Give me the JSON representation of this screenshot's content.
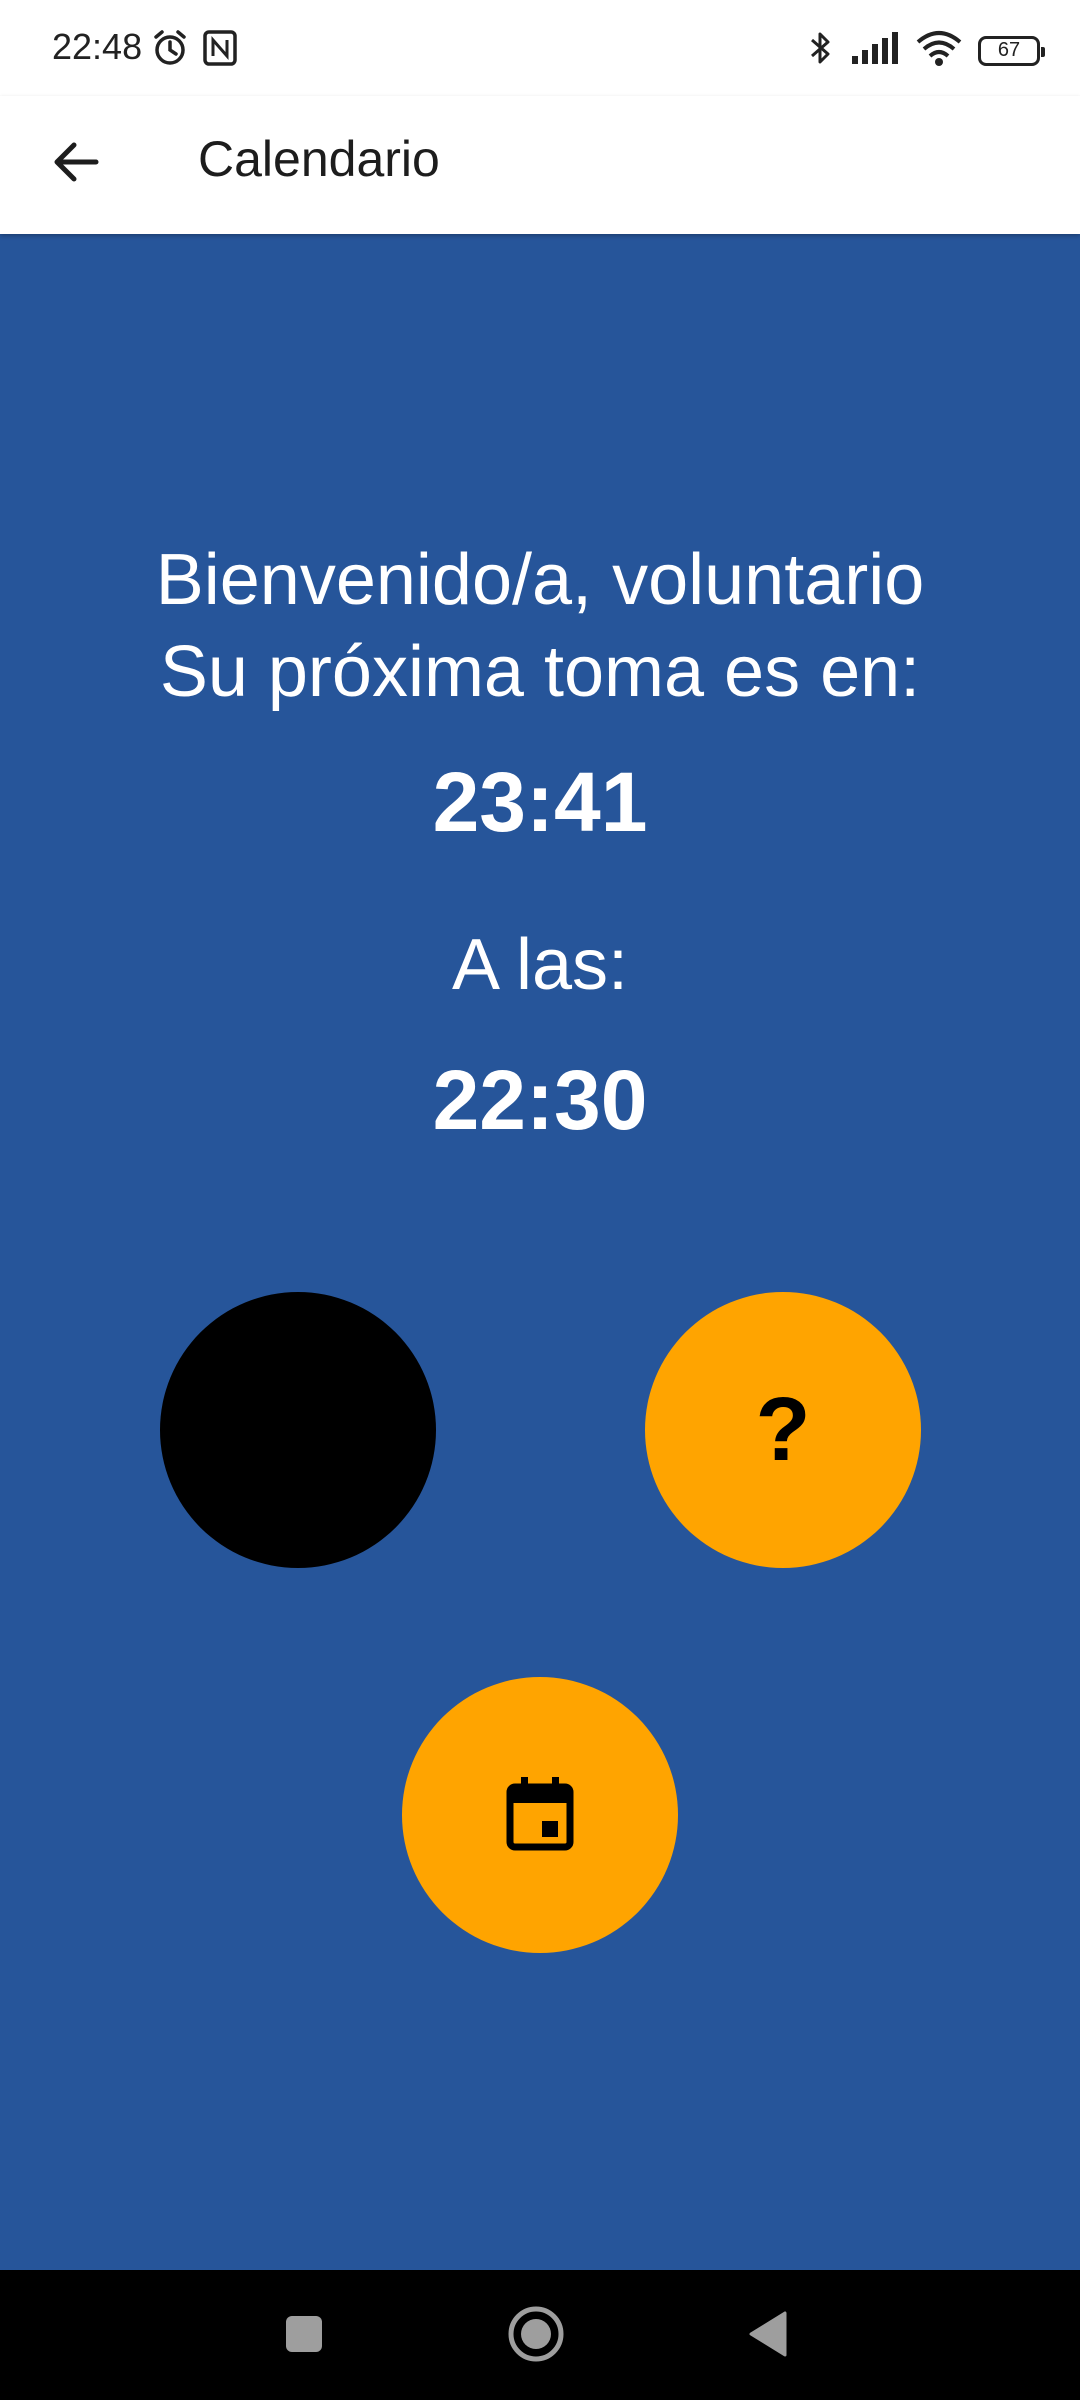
{
  "status_bar": {
    "time": "22:48",
    "battery_level": "67",
    "icons": [
      "alarm-icon",
      "nfc-icon",
      "bluetooth-icon",
      "signal-icon",
      "wifi-icon",
      "battery-icon"
    ]
  },
  "app_bar": {
    "title": "Calendario",
    "back_icon": "arrow-back-icon"
  },
  "main": {
    "greeting_line1": "Bienvenido/a, voluntario",
    "greeting_line2": "Su próxima toma es en:",
    "countdown": "23:41",
    "at_label": "A las:",
    "at_time": "22:30",
    "help_label": "?",
    "calendar_icon": "calendar-icon"
  },
  "colors": {
    "background": "#26559a",
    "accent": "#ffa400",
    "dark_button": "#000000",
    "text": "#ffffff"
  },
  "nav_bar": {
    "icons": [
      "recent-apps-icon",
      "home-icon",
      "back-icon"
    ]
  }
}
